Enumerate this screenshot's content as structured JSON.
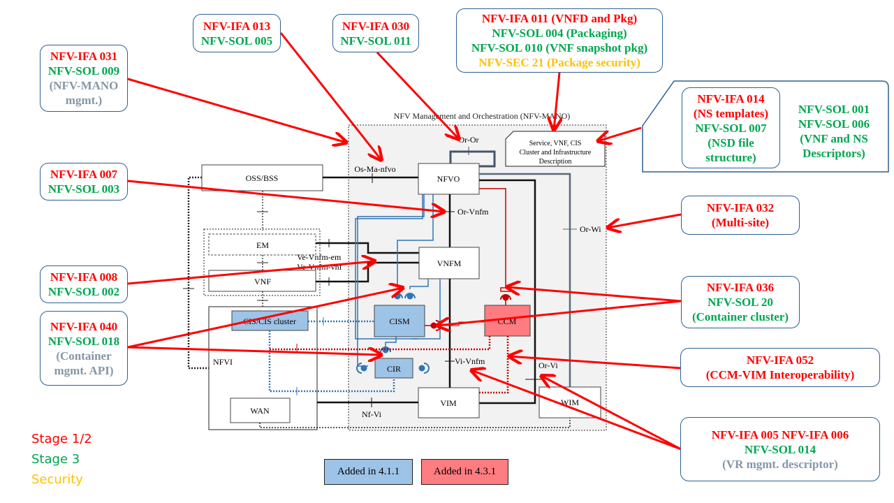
{
  "diagram": {
    "mano_title": "NFV Management and Orchestration (NFV-MANO)",
    "description_box": [
      "Service, VNF, CIS",
      "Cluster and Infrastructure",
      "Description"
    ],
    "blocks": {
      "oss_bss": "OSS/BSS",
      "nfvo": "NFVO",
      "em": "EM",
      "vnf": "VNF",
      "vnfm": "VNFM",
      "cis_cluster": "CIS/CIS cluster",
      "cism": "CISM",
      "cir": "CIR",
      "ccm": "CCM",
      "nfvi": "NFVI",
      "wan": "WAN",
      "vim": "VIM",
      "wim": "WIM"
    },
    "reference_points": {
      "or_or": "Or-Or",
      "os_ma_nfvo": "Os-Ma-nfvo",
      "or_vnfm": "Or-Vnfm",
      "or_wi": "Or-Wi",
      "ve_vnfm_em": "Ve-Vnfm-em",
      "ve_vnfm_vnf": "Ve-Vnfm-vnf",
      "vi_vnfm": "Vi-Vnfm",
      "or_vi": "Or-Vi",
      "nf_vi": "Nf-Vi"
    },
    "colors": {
      "added_411": "#9dc3e6",
      "added_431": "#ff7c80",
      "arrow": "#ff0000",
      "mano_bg": "#f2f2f2",
      "blue_link": "#2e75b6",
      "red_link": "#c00000"
    }
  },
  "callouts": {
    "ifa031": {
      "lines": [
        "NFV-IFA  031",
        "NFV-SOL 009",
        "(NFV-MANO",
        "mgmt.)"
      ]
    },
    "ifa013": {
      "lines": [
        "NFV-IFA 013",
        "NFV-SOL 005"
      ]
    },
    "ifa030": {
      "lines": [
        "NFV-IFA 030",
        "NFV-SOL 011"
      ]
    },
    "ifa011": {
      "lines": [
        "NFV-IFA  011 (VNFD and Pkg)",
        "NFV-SOL 004 (Packaging)",
        "NFV-SOL 010 (VNF snapshot pkg)",
        "NFV-SEC 21 (Package security)"
      ]
    },
    "ifa014": {
      "lines": [
        "NFV-IFA 014",
        "(NS templates)",
        "NFV-SOL 007",
        "(NSD file",
        "structure)"
      ]
    },
    "sol001": {
      "lines": [
        "NFV-SOL 001",
        "NFV-SOL 006",
        "(VNF and NS",
        "Descriptors)"
      ]
    },
    "ifa007": {
      "lines": [
        "NFV-IFA  007",
        "NFV-SOL 003"
      ]
    },
    "ifa032": {
      "lines": [
        "NFV-IFA  032",
        "(Multi-site)"
      ]
    },
    "ifa008": {
      "lines": [
        "NFV-IFA 008",
        "NFV-SOL 002"
      ]
    },
    "ifa036": {
      "lines": [
        "NFV-IFA 036",
        "NFV-SOL 20",
        "(Container cluster)"
      ]
    },
    "ifa040": {
      "lines": [
        "NFV-IFA 040",
        "NFV-SOL 018",
        "(Container",
        "mgmt. API)"
      ]
    },
    "ifa052": {
      "lines": [
        "NFV-IFA 052",
        "(CCM-VIM Interoperability)"
      ]
    },
    "ifa005": {
      "lines": [
        "NFV-IFA 005 NFV-IFA 006",
        "NFV-SOL 014",
        "(VR mgmt. descriptor)"
      ]
    }
  },
  "legend": {
    "stage12": "Stage 1/2",
    "stage3": "Stage 3",
    "security": "Security",
    "added_411": "Added in 4.1.1",
    "added_431": "Added in 4.3.1"
  }
}
